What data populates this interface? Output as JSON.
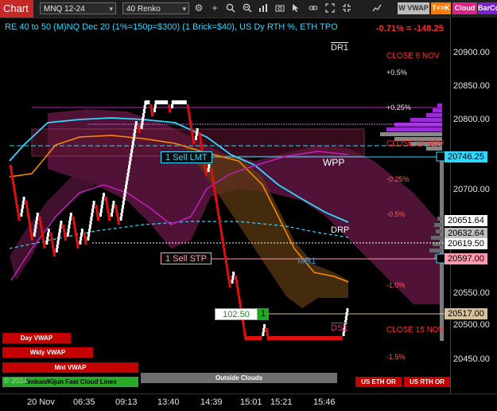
{
  "toolbar": {
    "chart_tab": "Chart",
    "instrument": "MNQ 12-24",
    "bar_type": "40 Renko",
    "pills": {
      "wvwap": "W VWAP",
      "tk": "T<>K",
      "cloud": "Cloud",
      "barco": "BarCo"
    },
    "icons": [
      "dropdown-arrow-icon",
      "gear-icon",
      "plus-icon",
      "magnifier-icon",
      "magnifier-minus-icon",
      "bars-icon",
      "screenshot-icon",
      "pointer-icon",
      "link-icon",
      "expand-icon",
      "collapse-icon"
    ]
  },
  "header": {
    "title": "RE 40 to 50 (M)NQ Dec 20 (1%=150p=$300) (1 Brick=$40), US Dy RTH %, ETH TPO",
    "change": "-0.71% = -148.25"
  },
  "levels": {
    "dr1": "DR1",
    "ds1": "DS1",
    "wpp": "WPP",
    "drp": "DRP",
    "mr1": "MR1",
    "close_6nov": "CLOSE 6 NOV",
    "close_19nov": "CLOSE 19 NOV",
    "close_15nov": "CLOSE 15 NOV",
    "pct_p1": "+0.5%",
    "pct_p025": "+0.25%",
    "pct_m025": "-0.25%",
    "pct_m05": "-0.5%",
    "pct_m1": "-1.0%",
    "pct_m15": "-1.5%"
  },
  "orders": {
    "sell_lmt": "1 Sell LMT",
    "sell_stp": "1 Sell STP",
    "pos_price": "102.50",
    "pos_qty": "1"
  },
  "y_axis": {
    "ticks": [
      "20900.00",
      "20850.00",
      "20800.00",
      "20700.00",
      "20550.00",
      "20500.00",
      "20450.00"
    ],
    "tags": {
      "p20746": "20746.25",
      "p20651": "20651.64",
      "p20632": "20632.64",
      "p20619": "20619.50",
      "p20597": "20597.00",
      "p20517": "20517.00"
    }
  },
  "x_axis": {
    "ticks": [
      "20 Nov",
      "06:35",
      "09:13",
      "13:40",
      "14:39",
      "15:01",
      "15:21",
      "15:46"
    ]
  },
  "bottom_buttons": {
    "day_vwap": "Day VWAP",
    "wkly_vwap": "Wkly VWAP",
    "mnt_vwap": "Mnt VWAP",
    "kijun": "Tenkan/Kijun Fast Cloud Lines",
    "outside_clouds": "Outside Clouds",
    "us_eth": "US ETH OR",
    "us_rth": "US RTH OR",
    "copyright": "© 2024"
  },
  "colors": {
    "up_brick": "#ffffff",
    "down_brick": "#e01010",
    "cloud": "#6b1a4a",
    "cyan": "#2fd8ff",
    "orange": "#ff8c00",
    "magenta": "#c020c0",
    "profile": "#9a2bd6"
  }
}
